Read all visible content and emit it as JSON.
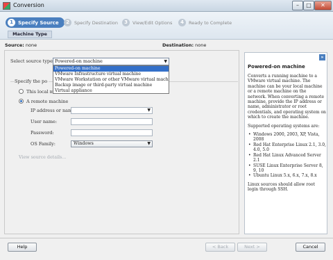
{
  "window": {
    "title": "Conversion",
    "min": "–",
    "max": "□",
    "close": "✕"
  },
  "steps": [
    {
      "num": "1",
      "label": "Specify Source"
    },
    {
      "num": "2",
      "label": "Specify Destination"
    },
    {
      "num": "3",
      "label": "View/Edit Options"
    },
    {
      "num": "4",
      "label": "Ready to Complete"
    }
  ],
  "subtab": "Machine Type",
  "source_line": {
    "source_label": "Source:",
    "source_value": "none",
    "dest_label": "Destination:",
    "dest_value": "none"
  },
  "form": {
    "source_type_label": "Select source type:",
    "source_type_value": "Powered-on machine",
    "dropdown_options": [
      "Powered-on machine",
      "VMware Infrastructure virtual machine",
      "VMware Workstation or other VMware virtual machine",
      "Backup image or third-party virtual machine",
      "Virtual appliance"
    ],
    "specify_label": "Specify the po",
    "radio_local": "This local m",
    "radio_remote": "A remote machine",
    "ip_label": "IP address or name:",
    "user_label": "User name:",
    "password_label": "Password:",
    "os_label": "OS Family:",
    "os_value": "Windows",
    "view_details": "View source details..."
  },
  "help": {
    "expand": "»",
    "title": "Powered-on machine",
    "para1": "Converts a running machine to a VMware virtual machine. The machine can be your local machine or a remote machine on the network. When converting a remote machine, provide the IP address or name, administrator or root credentials, and operating system on which to create the machine.",
    "para2": "Supported operating systems are:",
    "os_list": [
      "Windows 2000, 2003, XP, Vista, 2008",
      "Red Hat Enterprise Linux 2.1, 3.0, 4.0, 5.0",
      "Red Hat Linux Advanced Server 2.1",
      "SUSE Linux Enterprise Server 8, 9, 10",
      "Ubuntu Linux 5.x, 6.x, 7.x, 8.x"
    ],
    "para3": "Linux sources should allow root login through SSH."
  },
  "buttons": {
    "help": "Help",
    "back": "< Back",
    "next": "Next >",
    "cancel": "Cancel"
  }
}
